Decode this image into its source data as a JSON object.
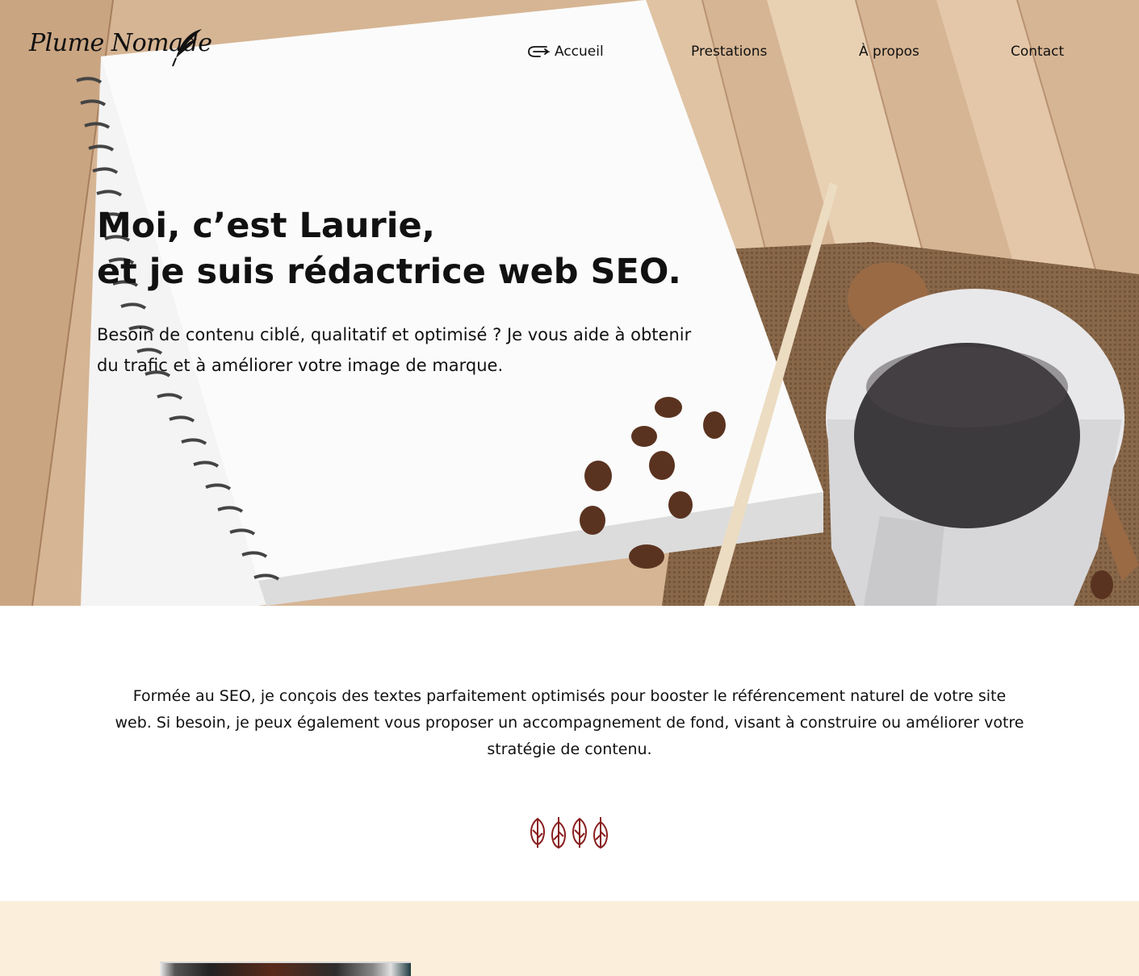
{
  "logo": {
    "text": "Plume Nomade",
    "icon": "quill-icon"
  },
  "nav": {
    "items": [
      {
        "label": "Accueil",
        "active": true,
        "icon": "pen-pointer-icon"
      },
      {
        "label": "Prestations"
      },
      {
        "label": "À propos"
      },
      {
        "label": "Contact"
      }
    ]
  },
  "hero": {
    "title_line1": "Moi, c’est Laurie,",
    "title_line2": "et je suis rédactrice web SEO.",
    "subtitle": "Besoin de contenu ciblé, qualitatif et optimisé ? Je vous aide à obtenir du trafic et à améliorer votre image de marque."
  },
  "intro": {
    "text": "Formée au SEO, je conçois des textes parfaitement optimisés pour booster le référencement naturel de votre site web. Si besoin, je peux également vous proposer un accompagnement de fond, visant à construire ou améliorer votre stratégie de contenu.",
    "divider_icon": "feathers-icon",
    "accent": "#8a1f1f"
  },
  "colors": {
    "beige_section": "#fbeedb",
    "text": "#111111"
  }
}
